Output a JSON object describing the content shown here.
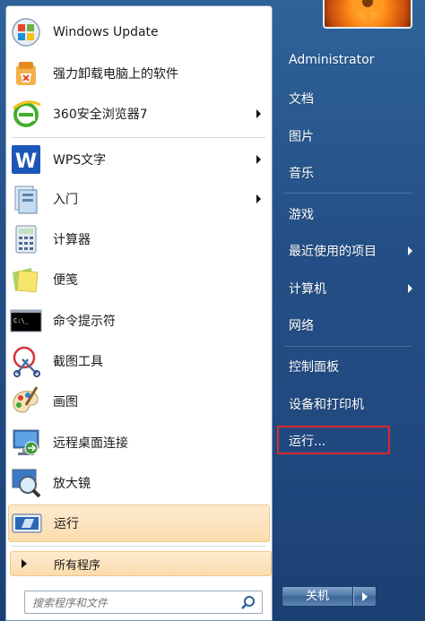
{
  "programs": [
    {
      "label": "Windows Update",
      "icon": "windows-update-icon",
      "submenu": false
    },
    {
      "label": "强力卸载电脑上的软件",
      "icon": "uninstaller-icon",
      "submenu": false
    },
    {
      "label": "360安全浏览器7",
      "icon": "360-browser-icon",
      "submenu": true
    },
    {
      "label": "WPS文字",
      "icon": "wps-writer-icon",
      "submenu": true
    },
    {
      "label": "入门",
      "icon": "getting-started-icon",
      "submenu": true
    },
    {
      "label": "计算器",
      "icon": "calculator-icon",
      "submenu": false
    },
    {
      "label": "便笺",
      "icon": "sticky-notes-icon",
      "submenu": false
    },
    {
      "label": "命令提示符",
      "icon": "command-prompt-icon",
      "submenu": false
    },
    {
      "label": "截图工具",
      "icon": "snipping-tool-icon",
      "submenu": false
    },
    {
      "label": "画图",
      "icon": "paint-icon",
      "submenu": false
    },
    {
      "label": "远程桌面连接",
      "icon": "remote-desktop-icon",
      "submenu": false
    },
    {
      "label": "放大镜",
      "icon": "magnifier-icon",
      "submenu": false
    },
    {
      "label": "运行",
      "icon": "run-icon",
      "submenu": false,
      "highlighted": true
    }
  ],
  "all_programs": "所有程序",
  "search": {
    "placeholder": "搜索程序和文件"
  },
  "cmd_icon_text": "C:\\_",
  "right": {
    "user": "Administrator",
    "items": [
      {
        "label": "文档",
        "submenu": false
      },
      {
        "label": "图片",
        "submenu": false
      },
      {
        "label": "音乐",
        "submenu": false
      },
      {
        "label": "游戏",
        "submenu": false
      },
      {
        "label": "最近使用的项目",
        "submenu": true
      },
      {
        "label": "计算机",
        "submenu": true
      },
      {
        "label": "网络",
        "submenu": false
      },
      {
        "label": "控制面板",
        "submenu": false
      },
      {
        "label": "设备和打印机",
        "submenu": false
      },
      {
        "label": "运行...",
        "submenu": false,
        "boxed": true
      }
    ]
  },
  "shutdown": {
    "label": "关机"
  },
  "colors": {
    "highlight": "#fbdcae",
    "panel": "#20487e",
    "redbox": "#e0262b"
  }
}
